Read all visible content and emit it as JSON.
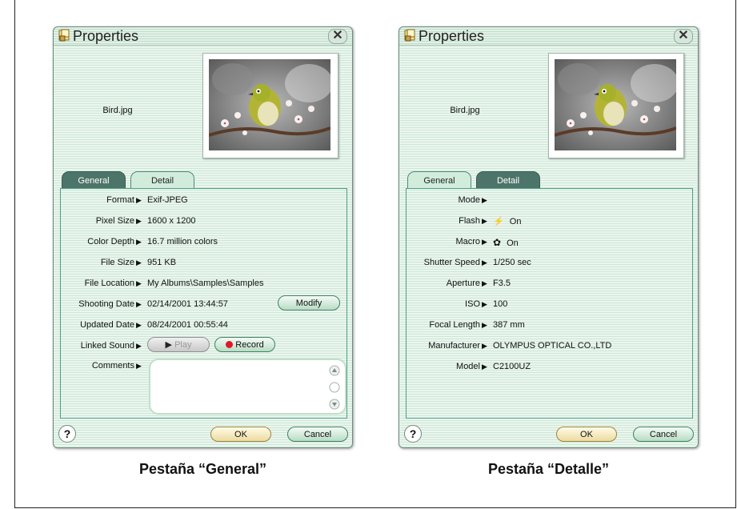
{
  "captions": {
    "general": "Pestaña “General”",
    "detail": "Pestaña “Detalle”"
  },
  "dialog_general": {
    "title": "Properties",
    "close_glyph": "✕",
    "filename": "Bird.jpg",
    "tabs": {
      "general": "General",
      "detail": "Detail"
    },
    "rows": [
      {
        "label": "Format",
        "value": "Exif-JPEG"
      },
      {
        "label": "Pixel Size",
        "value": "1600 x 1200"
      },
      {
        "label": "Color Depth",
        "value": "16.7 million colors"
      },
      {
        "label": "File Size",
        "value": "951 KB"
      },
      {
        "label": "File Location",
        "value": "My Albums\\Samples\\Samples"
      },
      {
        "label": "Shooting Date",
        "value": "02/14/2001 13:44:57"
      },
      {
        "label": "Updated Date",
        "value": "08/24/2001 00:55:44"
      },
      {
        "label": "Linked Sound",
        "value": ""
      },
      {
        "label": "Comments",
        "value": ""
      }
    ],
    "modify_label": "Modify",
    "play_label": "Play",
    "record_label": "Record",
    "help_glyph": "?",
    "ok_label": "OK",
    "cancel_label": "Cancel"
  },
  "dialog_detail": {
    "title": "Properties",
    "close_glyph": "✕",
    "filename": "Bird.jpg",
    "tabs": {
      "general": "General",
      "detail": "Detail"
    },
    "rows": [
      {
        "label": "Mode",
        "value": ""
      },
      {
        "label": "Flash",
        "value": "On",
        "icon": "flash-icon"
      },
      {
        "label": "Macro",
        "value": "On",
        "icon": "macro-flower-icon"
      },
      {
        "label": "Shutter Speed",
        "value": "1/250 sec"
      },
      {
        "label": "Aperture",
        "value": "F3.5"
      },
      {
        "label": "ISO",
        "value": "100"
      },
      {
        "label": "Focal Length",
        "value": "387 mm"
      },
      {
        "label": "Manufacturer",
        "value": "OLYMPUS OPTICAL CO.,LTD"
      },
      {
        "label": "Model",
        "value": "C2100UZ"
      }
    ],
    "help_glyph": "?",
    "ok_label": "OK",
    "cancel_label": "Cancel"
  },
  "icons": {
    "arrow": "▶",
    "flash": "⚡",
    "macro": "✿",
    "play": "▶"
  },
  "colors": {
    "active_tab": "#4d7468",
    "panel_border": "#49a08a",
    "record_dot": "#e0192a"
  }
}
